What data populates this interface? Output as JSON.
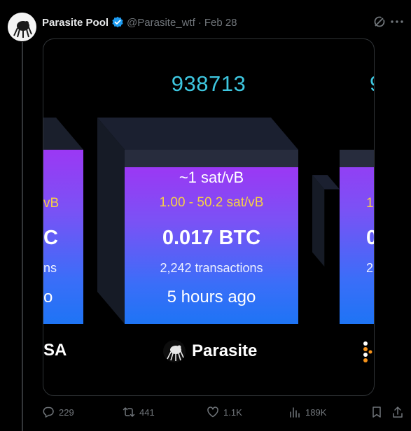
{
  "post": {
    "author_name": "Parasite Pool",
    "handle": "@Parasite_wtf",
    "separator": "·",
    "date": "Feb 28"
  },
  "block": {
    "height": "938713",
    "height_partial_right": "9",
    "median_fee": "~1 sat/vB",
    "fee_range": "1.00 - 50.2 sat/vB",
    "total_fees": "0.017 BTC",
    "tx_count": "2,242 transactions",
    "time_ago": "5 hours ago",
    "pool_name": "Parasite"
  },
  "left_block": {
    "fee_range_partial": "vB",
    "fees_partial": "C",
    "tx_partial": "ns",
    "time_partial": "o",
    "pool_partial": "SA"
  },
  "right_block": {
    "fee_range_partial": "1",
    "fees_partial": "0",
    "tx_partial": "2,"
  },
  "actions": {
    "replies": "229",
    "reposts": "441",
    "likes": "1.1K",
    "views": "189K"
  },
  "colors": {
    "accent_cyan": "#3ec7e0",
    "fee_yellow": "#f7d046",
    "gradient_top": "#9b38f4",
    "gradient_bottom": "#1e74f5",
    "verified_blue": "#1d9bf0"
  },
  "icons": [
    "verified-badge-icon",
    "grok-icon",
    "more-icon",
    "reply-icon",
    "repost-icon",
    "like-icon",
    "views-icon",
    "bookmark-icon",
    "share-icon",
    "parasite-logo-icon"
  ]
}
